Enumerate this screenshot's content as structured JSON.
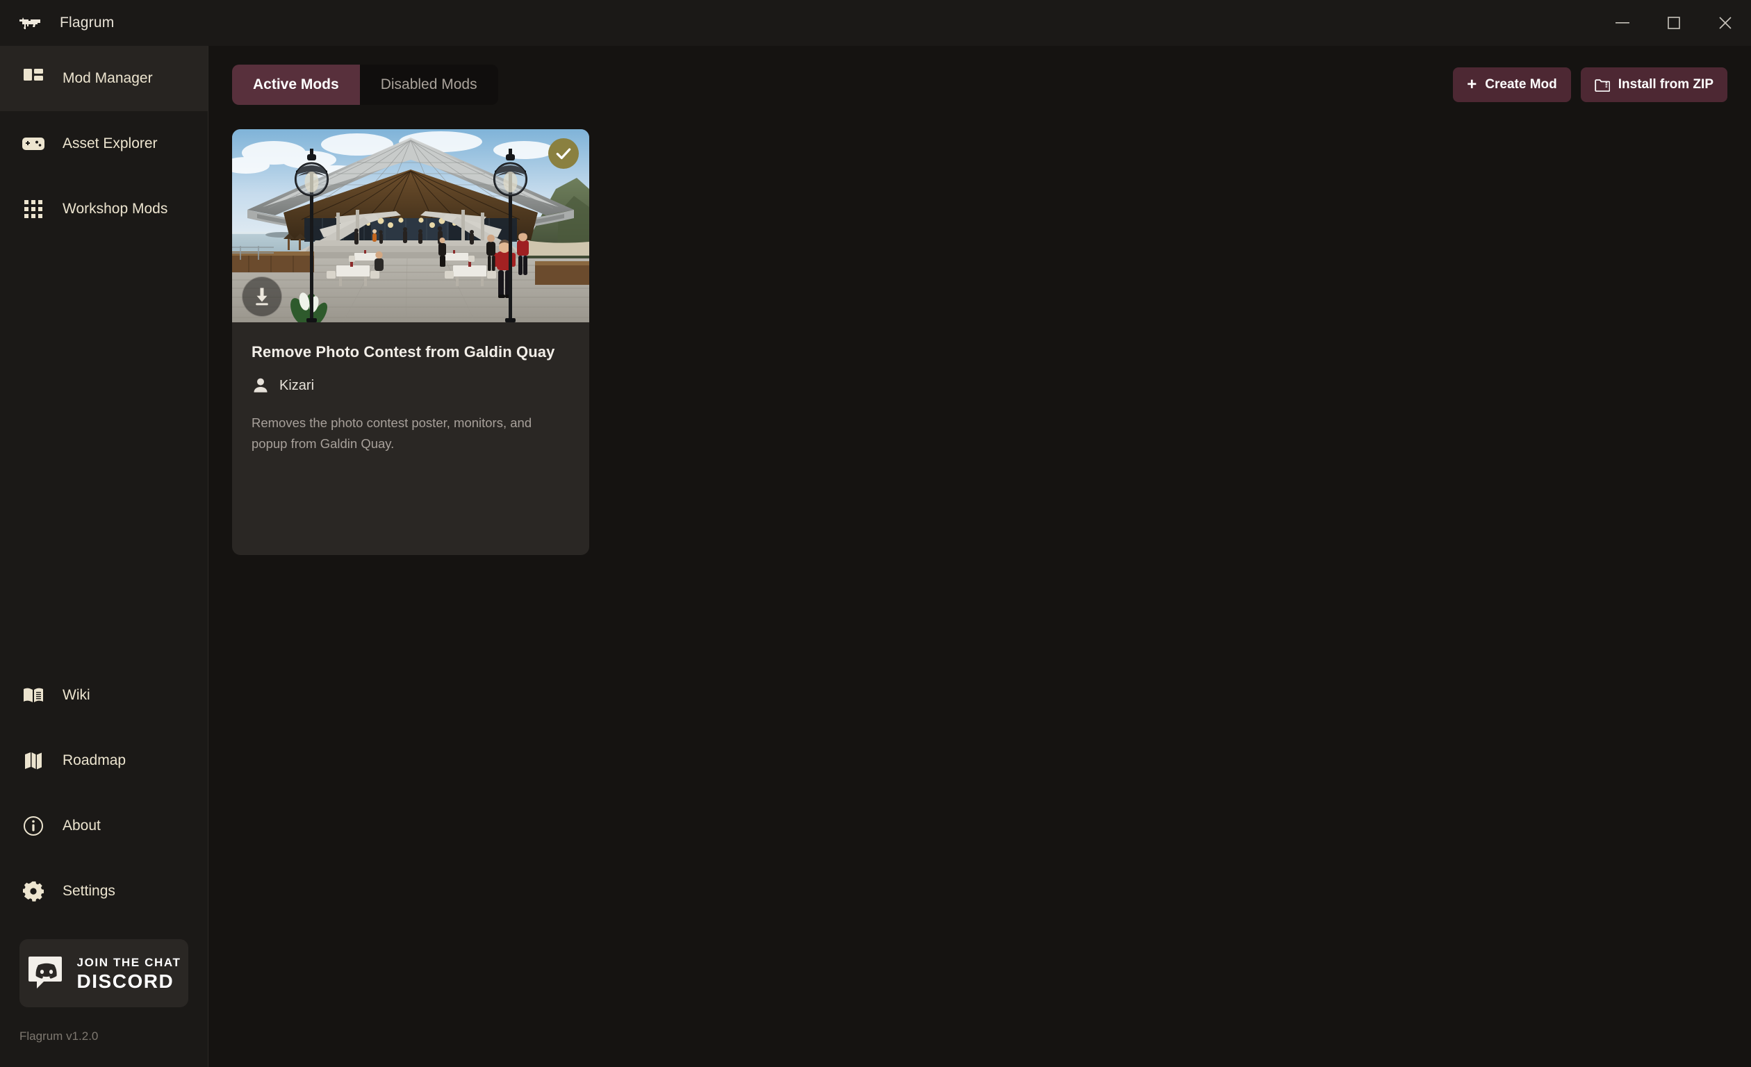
{
  "window": {
    "title": "Flagrum",
    "logo_icon": "rifle-icon",
    "controls": {
      "minimize_icon": "minimize-icon",
      "maximize_icon": "maximize-icon",
      "close_icon": "close-icon"
    }
  },
  "sidebar": {
    "primary_items": [
      {
        "label": "Mod Manager",
        "icon": "dashboard-grid-icon",
        "active": true
      },
      {
        "label": "Asset Explorer",
        "icon": "gamepad-icon",
        "active": false
      },
      {
        "label": "Workshop Mods",
        "icon": "apps-grid-icon",
        "active": false
      }
    ],
    "secondary_items": [
      {
        "label": "Wiki",
        "icon": "open-book-icon"
      },
      {
        "label": "Roadmap",
        "icon": "map-icon"
      },
      {
        "label": "About",
        "icon": "info-circle-icon"
      },
      {
        "label": "Settings",
        "icon": "gear-icon"
      }
    ],
    "discord": {
      "top_text": "JOIN THE CHAT",
      "bottom_text": "DISCORD",
      "icon": "discord-icon"
    },
    "version": "Flagrum v1.2.0"
  },
  "toolbar": {
    "tabs": [
      {
        "label": "Active Mods",
        "active": true
      },
      {
        "label": "Disabled Mods",
        "active": false
      }
    ],
    "create_mod_label": "Create Mod",
    "create_mod_icon": "plus-icon",
    "install_zip_label": "Install from ZIP",
    "install_zip_icon": "folder-zip-icon"
  },
  "mods": [
    {
      "title": "Remove Photo Contest from Galdin Quay",
      "author": "Kizari",
      "author_icon": "person-icon",
      "description": "Removes the photo contest poster, monitors, and popup from Galdin Quay.",
      "enabled_badge_icon": "check-icon",
      "download_icon": "download-icon",
      "thumbnail_alt": "Galdin Quay pavilion with conical roof, lampposts, wooden deck, dining tables and staff in red uniforms beside the ocean"
    }
  ],
  "colors": {
    "accent_maroon": "#4d2833",
    "tab_active": "#58303c",
    "sidebar_bg": "#1b1917",
    "main_bg": "#151311",
    "card_bg": "#2a2724",
    "nav_text": "#ece4cf",
    "enabled_badge": "#8a8040"
  }
}
